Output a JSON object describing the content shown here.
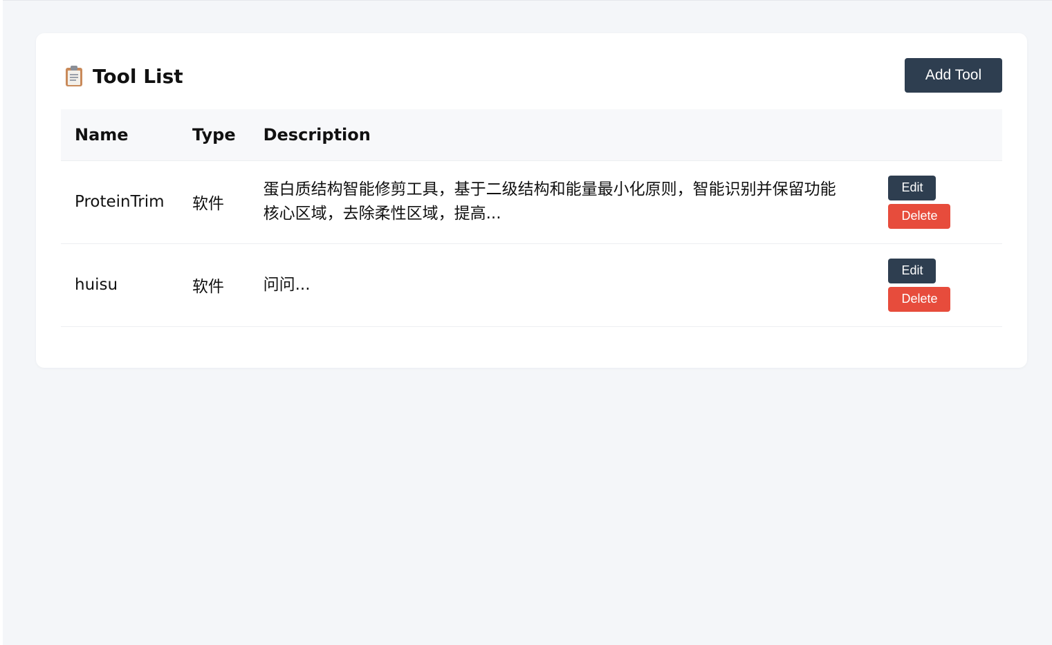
{
  "header": {
    "icon": "clipboard-icon",
    "title": "Tool List",
    "add_button_label": "Add Tool"
  },
  "table": {
    "columns": [
      "Name",
      "Type",
      "Description",
      ""
    ],
    "rows": [
      {
        "name": "ProteinTrim",
        "type": "软件",
        "description": "蛋白质结构智能修剪工具，基于二级结构和能量最小化原则，智能识别并保留功能核心区域，去除柔性区域，提高...",
        "edit_label": "Edit",
        "delete_label": "Delete"
      },
      {
        "name": "huisu",
        "type": "软件",
        "description": "问问...",
        "edit_label": "Edit",
        "delete_label": "Delete"
      }
    ]
  },
  "colors": {
    "primary": "#2e3e50",
    "danger": "#e74c3c",
    "background": "#f4f6f9",
    "card": "#ffffff"
  }
}
